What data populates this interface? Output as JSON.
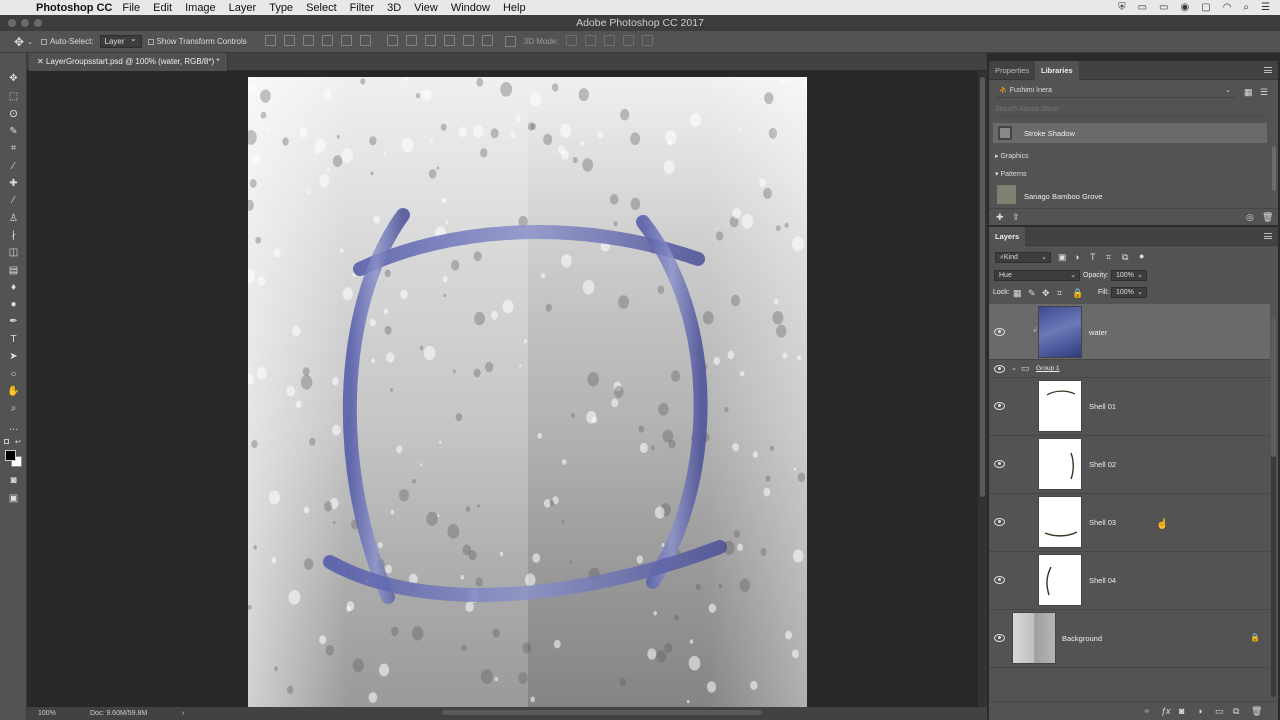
{
  "menubar": {
    "app_name": "Photoshop CC",
    "items": [
      "File",
      "Edit",
      "Image",
      "Layer",
      "Type",
      "Select",
      "Filter",
      "3D",
      "View",
      "Window",
      "Help"
    ]
  },
  "window": {
    "title": "Adobe Photoshop CC 2017"
  },
  "options_bar": {
    "auto_select_label": "Auto-Select:",
    "auto_select_target": "Layer",
    "show_transform_label": "Show Transform Controls",
    "mode_3d_label": "3D Mode:"
  },
  "document": {
    "tab_title": "LayerGroupsstart.psd @ 100% (water, RGB/8*) *",
    "zoom": "100%",
    "doc_size": "Doc: 9.60M/59.8M"
  },
  "libraries_panel": {
    "tabs": [
      "Properties",
      "Libraries"
    ],
    "active_tab": "Libraries",
    "library_name": "Fushimi Inera",
    "search_placeholder": "Search Adobe Stock",
    "styles_item": "Stroke Shadow",
    "sections": [
      "Graphics",
      "Patterns"
    ],
    "pattern_item": "Sanago Bamboo Grove"
  },
  "layers_panel": {
    "title": "Layers",
    "filter_kind": "Kind",
    "blend_mode": "Hue",
    "opacity_label": "Opacity:",
    "opacity_value": "100%",
    "lock_label": "Lock:",
    "fill_label": "Fill:",
    "fill_value": "100%",
    "layers": [
      {
        "name": "water",
        "selected": true
      },
      {
        "name": "Group 1",
        "type": "group",
        "expanded": true
      },
      {
        "name": "Shell 01"
      },
      {
        "name": "Shell 02"
      },
      {
        "name": "Shell 03"
      },
      {
        "name": "Shell 04"
      },
      {
        "name": "Background",
        "locked": true
      }
    ]
  },
  "colors": {
    "menubar": "#e8e8e8",
    "panel": "#535353",
    "canvas_bg": "#282828",
    "stroke_blue": "#6f78b8",
    "selected_layer": "#6a6a6a"
  }
}
